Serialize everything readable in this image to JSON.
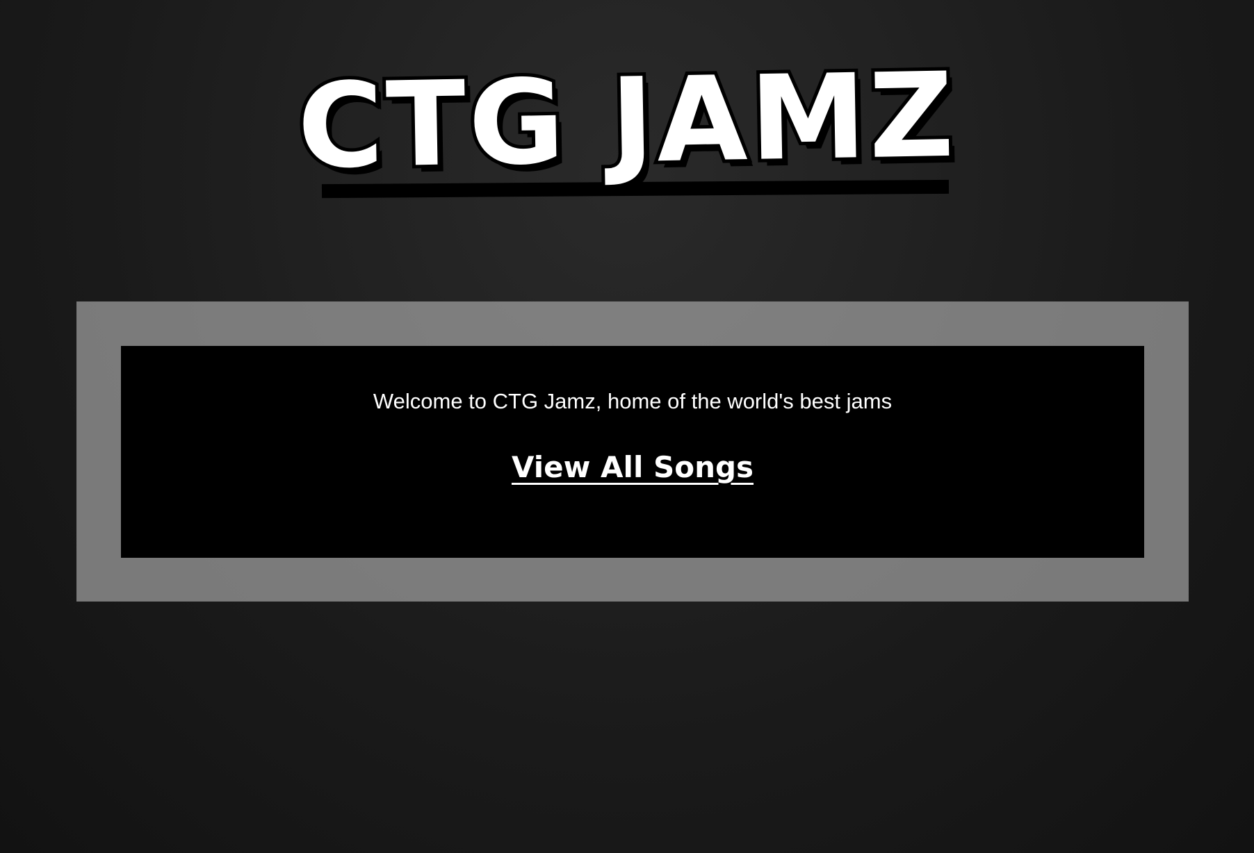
{
  "header": {
    "title": "CTG JAMZ"
  },
  "main": {
    "welcome_text": "Welcome to CTG Jamz, home of the world's best jams",
    "view_all_label": "View All Songs"
  },
  "colors": {
    "background": "#1b1b1b",
    "panel": "#000000",
    "frame": "#b0b0b0",
    "text": "#ffffff",
    "eq_top": "#39ff14",
    "eq_mid": "#00e5ff",
    "eq_low": "#e040fb"
  }
}
